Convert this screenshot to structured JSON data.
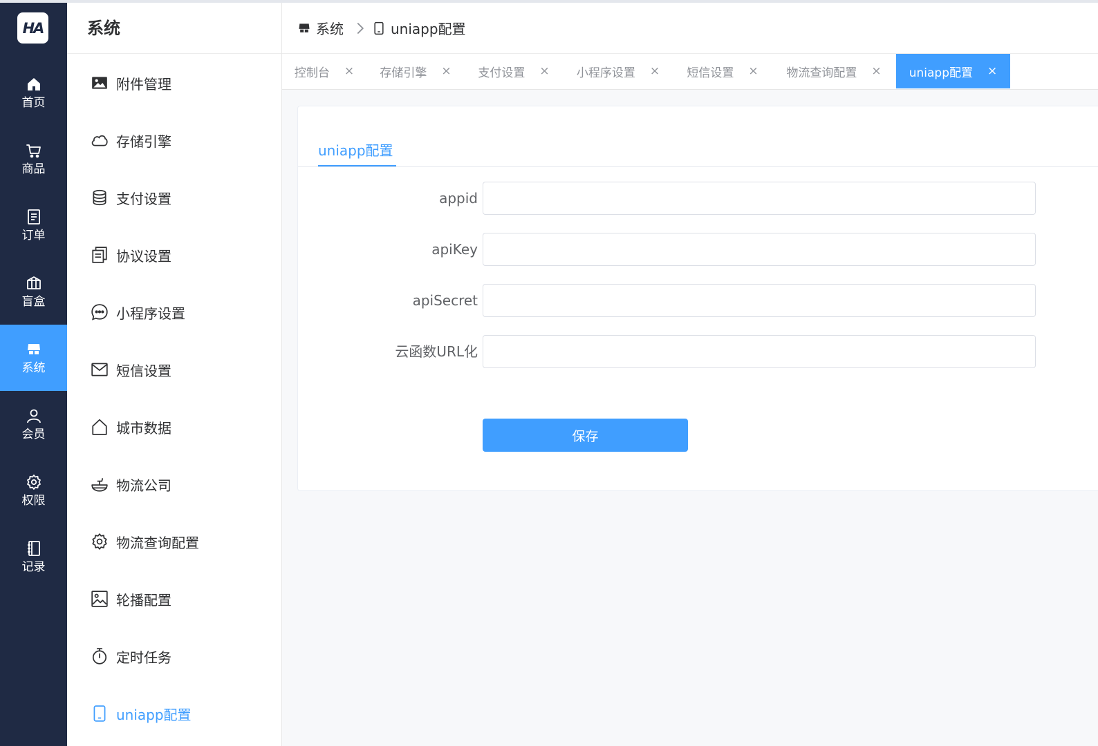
{
  "logo": {
    "text": "HA"
  },
  "rail": {
    "items": [
      {
        "label": "首页",
        "icon": "home-icon"
      },
      {
        "label": "商品",
        "icon": "cart-icon"
      },
      {
        "label": "订单",
        "icon": "order-icon"
      },
      {
        "label": "盲盒",
        "icon": "gift-box-icon"
      },
      {
        "label": "系统",
        "icon": "shop-icon",
        "active": true
      },
      {
        "label": "会员",
        "icon": "user-icon"
      },
      {
        "label": "权限",
        "icon": "gear-icon"
      },
      {
        "label": "记录",
        "icon": "notebook-icon"
      }
    ]
  },
  "submenu": {
    "title": "系统",
    "items": [
      {
        "label": "附件管理",
        "icon": "picture-filled-icon"
      },
      {
        "label": "存储引擎",
        "icon": "cloud-icon"
      },
      {
        "label": "支付设置",
        "icon": "coin-stack-icon"
      },
      {
        "label": "协议设置",
        "icon": "document-copy-icon"
      },
      {
        "label": "小程序设置",
        "icon": "chat-dots-icon"
      },
      {
        "label": "短信设置",
        "icon": "message-icon"
      },
      {
        "label": "城市数据",
        "icon": "house-icon"
      },
      {
        "label": "物流公司",
        "icon": "bowl-icon"
      },
      {
        "label": "物流查询配置",
        "icon": "setting-icon"
      },
      {
        "label": "轮播配置",
        "icon": "picture-icon"
      },
      {
        "label": "定时任务",
        "icon": "stopwatch-icon"
      },
      {
        "label": "uniapp配置",
        "icon": "cellphone-icon",
        "active": true
      }
    ]
  },
  "breadcrumb": {
    "items": [
      {
        "label": "系统",
        "icon": "shop-icon"
      },
      {
        "label": "uniapp配置",
        "icon": "cellphone-icon"
      }
    ]
  },
  "tabs": {
    "items": [
      {
        "label": "控制台"
      },
      {
        "label": "存储引擎"
      },
      {
        "label": "支付设置"
      },
      {
        "label": "小程序设置"
      },
      {
        "label": "短信设置"
      },
      {
        "label": "物流查询配置"
      },
      {
        "label": "uniapp配置",
        "active": true
      }
    ],
    "close_glyph": "×"
  },
  "form": {
    "tab_label": "uniapp配置",
    "fields": [
      {
        "label": "appid",
        "value": ""
      },
      {
        "label": "apiKey",
        "value": ""
      },
      {
        "label": "apiSecret",
        "value": ""
      },
      {
        "label": "云函数URL化",
        "value": ""
      }
    ],
    "save_label": "保存"
  },
  "colors": {
    "rail_bg": "#1f2a44",
    "accent": "#409eff",
    "page_bg": "#f7f8fa"
  }
}
